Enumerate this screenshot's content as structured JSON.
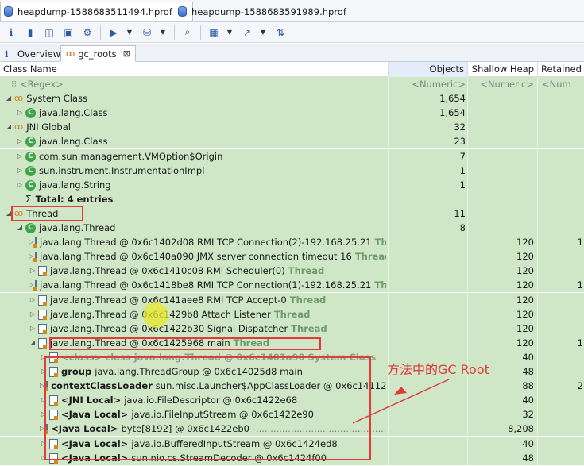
{
  "editor_tabs": [
    {
      "label": "heapdump-1588683511494.hprof",
      "close": "⊠",
      "active": true
    },
    {
      "label": "heapdump-1588683591989.hprof",
      "active": false
    }
  ],
  "view_tabs": [
    {
      "label": "Overview"
    },
    {
      "label": "gc_roots",
      "close": "⊠",
      "active": true
    }
  ],
  "columns": [
    "Class Name",
    "Objects",
    "Shallow Heap",
    "Retained Heap"
  ],
  "filter_row": {
    "name": "<Regex>",
    "objects": "<Numeric>",
    "shallow": "<Numeric>",
    "retained": "<Num"
  },
  "rows": [
    {
      "indent": 0,
      "twisty": "◢",
      "icon": "gc",
      "name": "System Class",
      "objects": "1,654"
    },
    {
      "indent": 1,
      "twisty": "▷",
      "icon": "class",
      "name": "java.lang.Class",
      "objects": "1,654"
    },
    {
      "indent": 0,
      "twisty": "◢",
      "icon": "gc",
      "name": "JNI Global",
      "objects": "32"
    },
    {
      "indent": 1,
      "twisty": "▷",
      "icon": "class",
      "name": "java.lang.Class",
      "objects": "23"
    },
    {
      "indent": 1,
      "twisty": "▷",
      "icon": "class",
      "name": "com.sun.management.VMOption$Origin",
      "objects": "7"
    },
    {
      "indent": 1,
      "twisty": "▷",
      "icon": "class",
      "name": "sun.instrument.InstrumentationImpl",
      "objects": "1"
    },
    {
      "indent": 1,
      "twisty": "▷",
      "icon": "class",
      "name": "java.lang.String",
      "objects": "1"
    },
    {
      "indent": 1,
      "twisty": "",
      "icon": "sigma",
      "name": "Total: 4 entries",
      "bold": true
    },
    {
      "indent": 0,
      "twisty": "◢",
      "icon": "gc",
      "name": "Thread",
      "objects": "11"
    },
    {
      "indent": 1,
      "twisty": "◢",
      "icon": "class",
      "name": "java.lang.Thread",
      "objects": "8"
    },
    {
      "indent": 2,
      "twisty": "▷",
      "icon": "obj",
      "name": "java.lang.Thread @ 0x6c1402d08  RMI TCP Connection(2)-192.168.25.21",
      "suffix": "Thread",
      "shallow": "120",
      "retained": "1"
    },
    {
      "indent": 2,
      "twisty": "▷",
      "icon": "obj",
      "name": "java.lang.Thread @ 0x6c140a090  JMX server connection timeout 16",
      "suffix": "Thread",
      "shallow": "120"
    },
    {
      "indent": 2,
      "twisty": "▷",
      "icon": "obj",
      "name": "java.lang.Thread @ 0x6c1410c08  RMI Scheduler(0)",
      "suffix": "Thread",
      "shallow": "120"
    },
    {
      "indent": 2,
      "twisty": "▷",
      "icon": "obj",
      "name": "java.lang.Thread @ 0x6c1418be8  RMI TCP Connection(1)-192.168.25.21",
      "suffix": "Thread",
      "shallow": "120",
      "retained": "1"
    },
    {
      "indent": 2,
      "twisty": "▷",
      "icon": "obj",
      "name": "java.lang.Thread @ 0x6c141aee8  RMI TCP Accept-0",
      "suffix": "Thread",
      "shallow": "120"
    },
    {
      "indent": 2,
      "twisty": "▷",
      "icon": "obj",
      "name": "java.lang.Thread @ 0x6c1429b8  Attach Listener",
      "suffix": "Thread",
      "shallow": "120"
    },
    {
      "indent": 2,
      "twisty": "▷",
      "icon": "obj",
      "name": "java.lang.Thread @ 0x6c1422b30  Signal Dispatcher",
      "suffix": "Thread",
      "shallow": "120"
    },
    {
      "indent": 2,
      "twisty": "◢",
      "icon": "obj",
      "name": "java.lang.Thread @ 0x6c1425968  main",
      "suffix": "Thread",
      "shallow": "120",
      "retained": "1"
    },
    {
      "indent": 3,
      "twisty": "▷",
      "icon": "file",
      "name": "<class> class java.lang.Thread @ 0x6c1401a90 System Class",
      "ghost": true,
      "shallow": "40"
    },
    {
      "indent": 3,
      "twisty": "▷",
      "icon": "file",
      "bold_prefix": "group",
      "name": "java.lang.ThreadGroup @ 0x6c14025d8  main",
      "shallow": "48"
    },
    {
      "indent": 3,
      "twisty": "▷",
      "icon": "file",
      "bold_prefix": "contextClassLoader",
      "name": "sun.misc.Launcher$AppClassLoader @ 0x6c1411200",
      "shallow": "88",
      "retained": "2"
    },
    {
      "indent": 3,
      "twisty": "▷",
      "icon": "file",
      "bold_prefix": "<JNI Local>",
      "name": "java.io.FileDescriptor @ 0x6c1422e68",
      "shallow": "40"
    },
    {
      "indent": 3,
      "twisty": "▷",
      "icon": "file",
      "bold_prefix": "<Java Local>",
      "name": "java.io.FileInputStream @ 0x6c1422e90",
      "shallow": "32"
    },
    {
      "indent": 3,
      "twisty": "▷",
      "icon": "file",
      "bold_prefix": "<Java Local>",
      "name": "byte[8192] @ 0x6c1422eb0",
      "dots": true,
      "shallow": "8,208"
    },
    {
      "indent": 3,
      "twisty": "▷",
      "icon": "file",
      "bold_prefix": "<Java Local>",
      "name": "java.io.BufferedInputStream @ 0x6c1424ed8",
      "shallow": "40"
    },
    {
      "indent": 3,
      "twisty": "▷",
      "icon": "file",
      "bold_prefix": "<Java Local>",
      "name": "sun.nio.cs.StreamDecoder @ 0x6c1424f00",
      "shallow": "48"
    }
  ],
  "annotation": "方法中的GC Root",
  "colors": {
    "row_bg": "#cfe7c6",
    "accent_red": "#e23b3b",
    "header_bg": "#ffffff"
  }
}
